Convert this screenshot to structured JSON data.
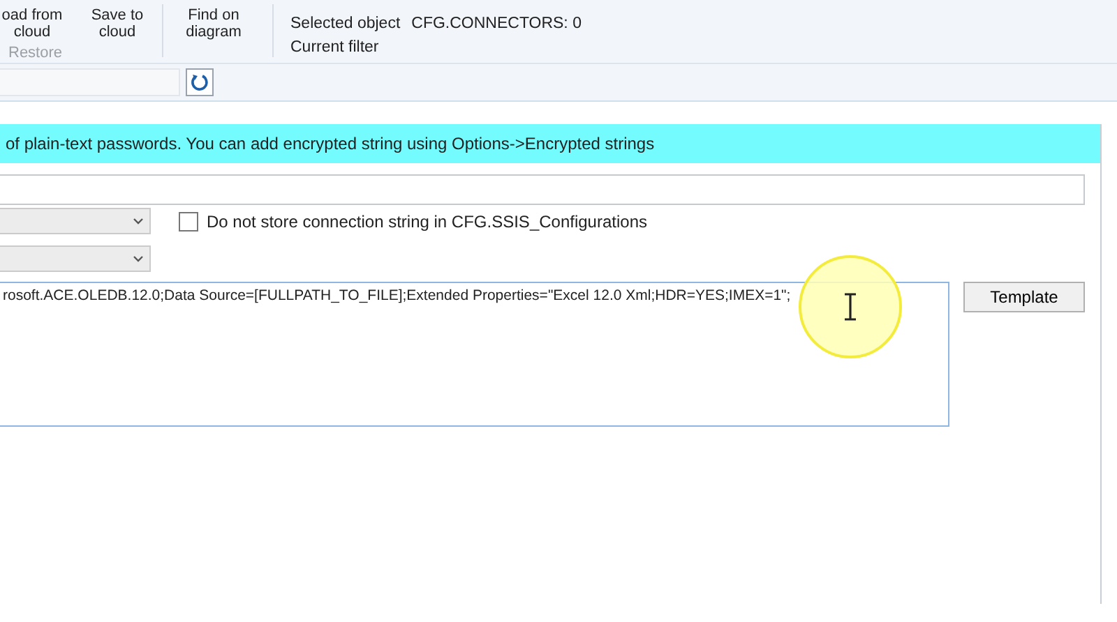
{
  "ribbon": {
    "buttons": [
      {
        "label": "oad from cloud"
      },
      {
        "label": "Restore",
        "disabled": true
      },
      {
        "label": "Save to cloud"
      },
      {
        "label": "Find on diagram"
      }
    ],
    "info": [
      {
        "label": "Selected object",
        "value": "CFG.CONNECTORS: 0"
      },
      {
        "label": "Current filter"
      }
    ]
  },
  "banner": {
    "text": "of plain-text passwords. You can add encrypted string using Options->Encrypted strings"
  },
  "checkbox": {
    "label": "Do not store connection string in CFG.SSIS_Configurations",
    "checked": false
  },
  "connection_string": {
    "value": "rosoft.ACE.OLEDB.12.0;Data Source=[FULLPATH_TO_FILE];Extended Properties=\"Excel 12.0 Xml;HDR=YES;IMEX=1\";"
  },
  "template_button": {
    "label": "Template"
  }
}
